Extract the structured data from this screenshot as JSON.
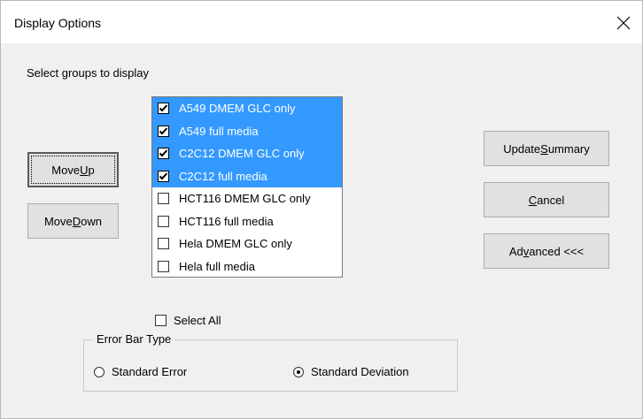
{
  "window": {
    "title": "Display Options",
    "close_icon": "close-icon"
  },
  "instructions": "Select groups to display",
  "buttons": {
    "move_up": {
      "pre": "Move ",
      "ul": "U",
      "post": "p"
    },
    "move_down": {
      "pre": "Move ",
      "ul": "D",
      "post": "own"
    },
    "update_summary": {
      "pre": "Update ",
      "ul": "S",
      "post": "ummary"
    },
    "cancel": {
      "pre": "",
      "ul": "C",
      "post": "ancel"
    },
    "advanced": {
      "pre": "Ad",
      "ul": "v",
      "post": "anced <<<"
    }
  },
  "groups": [
    {
      "label": "A549 DMEM GLC only",
      "checked": true,
      "selected": true
    },
    {
      "label": "A549 full media",
      "checked": true,
      "selected": true
    },
    {
      "label": "C2C12 DMEM GLC only",
      "checked": true,
      "selected": true
    },
    {
      "label": "C2C12 full media",
      "checked": true,
      "selected": true
    },
    {
      "label": "HCT116 DMEM GLC only",
      "checked": false,
      "selected": false
    },
    {
      "label": "HCT116 full media",
      "checked": false,
      "selected": false
    },
    {
      "label": "Hela DMEM GLC only",
      "checked": false,
      "selected": false
    },
    {
      "label": "Hela full media",
      "checked": false,
      "selected": false
    }
  ],
  "select_all": {
    "label": "Select All",
    "checked": false
  },
  "error_bar": {
    "legend": "Error Bar Type",
    "options": [
      {
        "label": "Standard Error",
        "selected": false
      },
      {
        "label": "Standard Deviation",
        "selected": true
      }
    ]
  }
}
